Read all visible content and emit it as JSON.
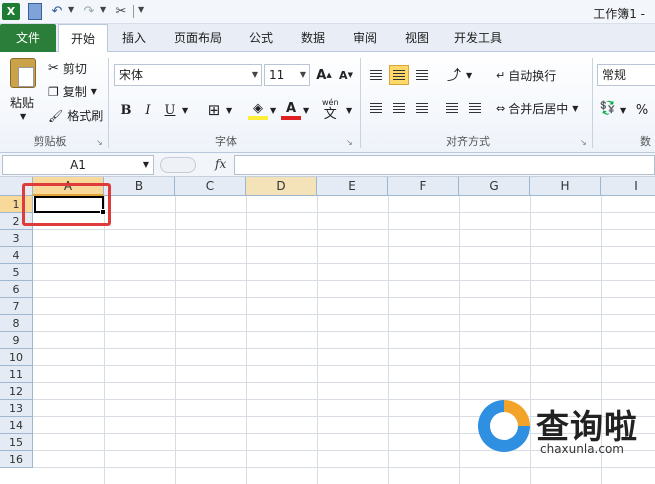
{
  "window": {
    "title": "工作簿1 -"
  },
  "qat": {
    "app_icon": "X",
    "undo_glyph": "↶",
    "redo_glyph": "↷",
    "tool_glyph": "✂"
  },
  "tabs": [
    {
      "id": "file",
      "label": "文件"
    },
    {
      "id": "home",
      "label": "开始"
    },
    {
      "id": "insert",
      "label": "插入"
    },
    {
      "id": "page-layout",
      "label": "页面布局"
    },
    {
      "id": "formulas",
      "label": "公式"
    },
    {
      "id": "data",
      "label": "数据"
    },
    {
      "id": "review",
      "label": "审阅"
    },
    {
      "id": "view",
      "label": "视图"
    },
    {
      "id": "developer",
      "label": "开发工具"
    }
  ],
  "ribbon": {
    "clipboard": {
      "paste": "粘贴",
      "cut": "剪切",
      "copy": "复制",
      "format_painter": "格式刷",
      "label": "剪贴板"
    },
    "font": {
      "name": "宋体",
      "size": "11",
      "bold": "B",
      "italic": "I",
      "underline": "U",
      "label": "字体",
      "grow": "A",
      "shrink": "A",
      "font_color_glyph": "A",
      "wen": "wén",
      "wen_char": "文"
    },
    "alignment": {
      "wrap": "自动换行",
      "merge": "合并后居中",
      "label": "对齐方式"
    },
    "number": {
      "format": "常规",
      "percent": "%",
      "label": "数"
    }
  },
  "formula_bar": {
    "name_box": "A1",
    "fx": "fx",
    "content": ""
  },
  "columns": [
    "A",
    "B",
    "C",
    "D",
    "E",
    "F",
    "G",
    "H",
    "I"
  ],
  "rows": [
    "1",
    "2",
    "3",
    "4",
    "5",
    "6",
    "7",
    "8",
    "9",
    "10",
    "11",
    "12",
    "13",
    "14",
    "15",
    "16"
  ],
  "watermark": {
    "main": "查询啦",
    "sub": "chaxunla.com"
  },
  "colors": {
    "file_tab": "#2b7d3a",
    "highlight": "#e03b3b",
    "selected_header": "#f9d99a",
    "accent_blue": "#2f8fe0",
    "accent_orange": "#f3a22a"
  }
}
